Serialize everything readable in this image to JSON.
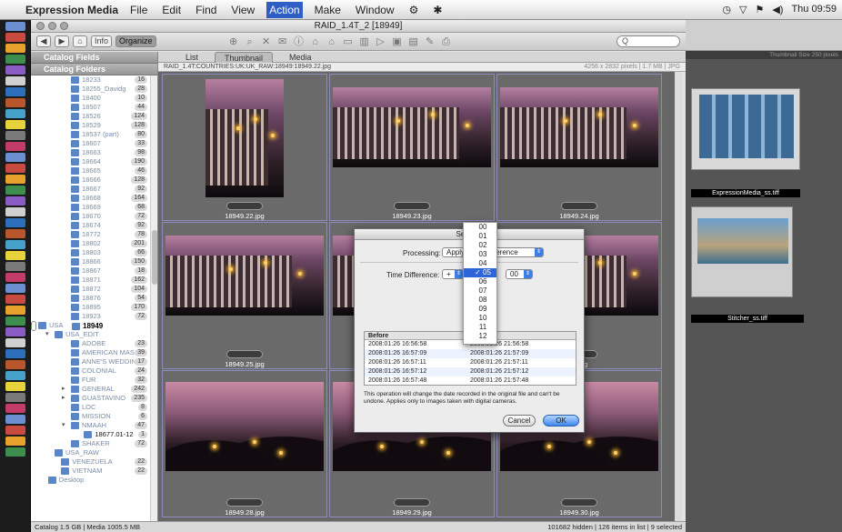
{
  "menubar": {
    "app": "Expression Media",
    "items": [
      "File",
      "Edit",
      "Find",
      "View",
      "Action",
      "Make",
      "Window"
    ],
    "active": "Action",
    "clock": "Thu 09:59"
  },
  "window": {
    "title": "RAID_1.4T_2 [18949]"
  },
  "toolbar": {
    "info_label": "Info",
    "organize_label": "Organize",
    "search_placeholder": "Q"
  },
  "sidebar": {
    "catalog_fields": "Catalog Fields",
    "catalog_folders": "Catalog Folders",
    "folders": [
      {
        "name": "18233",
        "count": "16",
        "indent": 1
      },
      {
        "name": "18255_Davidg",
        "count": "28",
        "indent": 1
      },
      {
        "name": "18400",
        "count": "10",
        "indent": 1
      },
      {
        "name": "18507",
        "count": "44",
        "indent": 1
      },
      {
        "name": "18526",
        "count": "124",
        "indent": 1
      },
      {
        "name": "18529",
        "count": "128",
        "indent": 1
      },
      {
        "name": "18537 (part)",
        "count": "80",
        "indent": 1
      },
      {
        "name": "18607",
        "count": "33",
        "indent": 1
      },
      {
        "name": "18663",
        "count": "98",
        "indent": 1
      },
      {
        "name": "18664",
        "count": "190",
        "indent": 1
      },
      {
        "name": "18665",
        "count": "46",
        "indent": 1
      },
      {
        "name": "18666",
        "count": "128",
        "indent": 1
      },
      {
        "name": "18667",
        "count": "92",
        "indent": 1
      },
      {
        "name": "18668",
        "count": "164",
        "indent": 1
      },
      {
        "name": "18669",
        "count": "68",
        "indent": 1
      },
      {
        "name": "18670",
        "count": "72",
        "indent": 1
      },
      {
        "name": "18674",
        "count": "92",
        "indent": 1
      },
      {
        "name": "18772",
        "count": "78",
        "indent": 1
      },
      {
        "name": "18802",
        "count": "201",
        "indent": 1
      },
      {
        "name": "18803",
        "count": "66",
        "indent": 1
      },
      {
        "name": "18866",
        "count": "150",
        "indent": 1
      },
      {
        "name": "18867",
        "count": "18",
        "indent": 1
      },
      {
        "name": "18871",
        "count": "162",
        "indent": 1
      },
      {
        "name": "18872",
        "count": "104",
        "indent": 1
      },
      {
        "name": "18876",
        "count": "54",
        "indent": 1
      },
      {
        "name": "18895",
        "count": "170",
        "indent": 1
      },
      {
        "name": "18923",
        "count": "72",
        "indent": 1
      },
      {
        "name": "18949",
        "count": "126",
        "indent": 1,
        "selected": true
      },
      {
        "name": "USA",
        "count": "",
        "indent": 0,
        "tri": "▾"
      },
      {
        "name": "USA_EDIT",
        "count": "",
        "indent": 0.5,
        "tri": "▾"
      },
      {
        "name": "ADOBE",
        "count": "23",
        "indent": 1
      },
      {
        "name": "AMERICAN MAS",
        "count": "39",
        "indent": 1
      },
      {
        "name": "ANNE'S WEDDIN",
        "count": "17",
        "indent": 1
      },
      {
        "name": "COLONIAL",
        "count": "24",
        "indent": 1
      },
      {
        "name": "FUR",
        "count": "32",
        "indent": 1
      },
      {
        "name": "GENERAL",
        "count": "242",
        "indent": 1,
        "tri": "▸"
      },
      {
        "name": "GUASTAVINO",
        "count": "235",
        "indent": 1,
        "tri": "▸"
      },
      {
        "name": "LOC",
        "count": "8",
        "indent": 1
      },
      {
        "name": "MISSION",
        "count": "6",
        "indent": 1
      },
      {
        "name": "NMAAH",
        "count": "47",
        "indent": 1,
        "tri": "▾"
      },
      {
        "name": "18677.01-12",
        "count": "1",
        "indent": 1.4,
        "dark": true
      },
      {
        "name": "SHAKER",
        "count": "72",
        "indent": 1
      },
      {
        "name": "USA_RAW",
        "count": "",
        "indent": 0.5
      },
      {
        "name": "VENEZUELA",
        "count": "22",
        "indent": 0.7
      },
      {
        "name": "VIETNAM",
        "count": "22",
        "indent": 0.7
      },
      {
        "name": "Desktop",
        "count": "",
        "indent": 0.3
      }
    ]
  },
  "tabs": [
    "List",
    "Thumbnail",
    "Media"
  ],
  "active_tab": "Thumbnail",
  "pathbar": {
    "path": "RAID_1.4T:COUNTRIES:UK:UK_RAW:18949:18949.22.jpg",
    "meta": "4256 x 2832 pixels  |  1.7 MB  |  JPG"
  },
  "thumbnails": [
    {
      "name": "18949.22.jpg",
      "style": "street"
    },
    {
      "name": "18949.23.jpg",
      "style": "street"
    },
    {
      "name": "18949.24.jpg",
      "style": "street"
    },
    {
      "name": "18949.25.jpg",
      "style": "street"
    },
    {
      "name": "",
      "style": "street"
    },
    {
      "name": ".7.jpg",
      "style": "street"
    },
    {
      "name": "18949.28.jpg",
      "style": "trees"
    },
    {
      "name": "18949.29.jpg",
      "style": "trees"
    },
    {
      "name": "18949.30.jpg",
      "style": "trees"
    }
  ],
  "status": {
    "left": "Catalog  1.5  GB  |  Media 1005.5 MB",
    "right": "101682 hidden  |  126 items in list  |  9 selected"
  },
  "bg_window": {
    "header": "Thumbnail Size  250 pixels",
    "items": [
      "ExpressionMedia_ss.tiff",
      "Stitcher_ss.tiff"
    ]
  },
  "dialog": {
    "title": "Set Cap",
    "processing_label": "Processing:",
    "processing_value": "Apply",
    "processing_value2": "ference",
    "time_diff_label": "Time Difference:",
    "sign": "+",
    "minutes": "00",
    "before_header": "Before",
    "rows": [
      [
        "2008:01:26 16:56:58",
        "2008:01:26 21:56:58"
      ],
      [
        "2008:01:26 16:57:09",
        "2008:01:26 21:57:09"
      ],
      [
        "2008:01:26 16:57:11",
        "2008:01:26 21:57:11"
      ],
      [
        "2008:01:26 16:57:12",
        "2008:01:26 21:57:12"
      ],
      [
        "2008:01:26 16:57:48",
        "2008:01:26 21:57:48"
      ]
    ],
    "note": "This operation will change the date recorded in the original file and can't be undone. Applies only to images taken with digital cameras.",
    "cancel": "Cancel",
    "ok": "OK"
  },
  "hour_popup": {
    "options": [
      "00",
      "01",
      "02",
      "03",
      "04",
      "05",
      "06",
      "07",
      "08",
      "09",
      "10",
      "11",
      "12"
    ],
    "selected": "05"
  }
}
